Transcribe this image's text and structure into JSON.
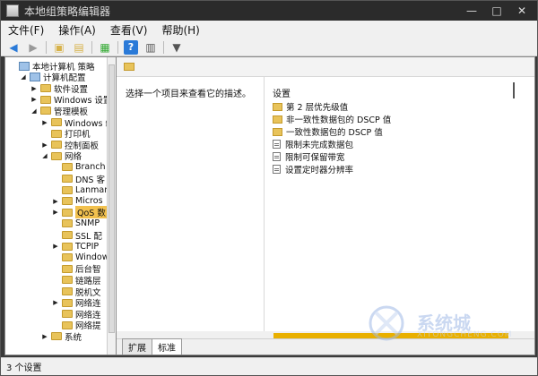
{
  "window": {
    "title": "本地组策略编辑器",
    "controls": [
      "—",
      "□",
      "✕"
    ]
  },
  "menubar": {
    "items": [
      "文件(F)",
      "操作(A)",
      "查看(V)",
      "帮助(H)"
    ]
  },
  "tree": {
    "items": [
      {
        "label": "本地计算机 策略",
        "level": 0,
        "expand": "",
        "icon": "computer-policy-icon"
      },
      {
        "label": "计算机配置",
        "level": 1,
        "expand": "◢",
        "icon": "computer-icon"
      },
      {
        "label": "软件设置",
        "level": 2,
        "expand": "▶",
        "icon": "folder-icon"
      },
      {
        "label": "Windows 设置",
        "level": 2,
        "expand": "▶",
        "icon": "folder-icon"
      },
      {
        "label": "管理模板",
        "level": 2,
        "expand": "◢",
        "icon": "folder-icon"
      },
      {
        "label": "Windows 组",
        "level": 3,
        "expand": "▶",
        "icon": "folder-icon"
      },
      {
        "label": "打印机",
        "level": 3,
        "expand": "",
        "icon": "folder-icon"
      },
      {
        "label": "控制面板",
        "level": 3,
        "expand": "▶",
        "icon": "folder-icon"
      },
      {
        "label": "网络",
        "level": 3,
        "expand": "◢",
        "icon": "folder-icon"
      },
      {
        "label": "Branch",
        "level": 4,
        "expand": "",
        "icon": "folder-icon"
      },
      {
        "label": "DNS 客",
        "level": 4,
        "expand": "",
        "icon": "folder-icon"
      },
      {
        "label": "Lanman",
        "level": 4,
        "expand": "",
        "icon": "folder-icon"
      },
      {
        "label": "Micros",
        "level": 4,
        "expand": "▶",
        "icon": "folder-icon"
      },
      {
        "label": "QoS 数",
        "level": 4,
        "expand": "▶",
        "icon": "folder-icon",
        "selected": true
      },
      {
        "label": "SNMP",
        "level": 4,
        "expand": "",
        "icon": "folder-icon"
      },
      {
        "label": "SSL 配",
        "level": 4,
        "expand": "",
        "icon": "folder-icon"
      },
      {
        "label": "TCPIP",
        "level": 4,
        "expand": "▶",
        "icon": "folder-icon"
      },
      {
        "label": "Window",
        "level": 4,
        "expand": "",
        "icon": "folder-icon"
      },
      {
        "label": "后台智",
        "level": 4,
        "expand": "",
        "icon": "folder-icon"
      },
      {
        "label": "链路层",
        "level": 4,
        "expand": "",
        "icon": "folder-icon"
      },
      {
        "label": "脱机文",
        "level": 4,
        "expand": "",
        "icon": "folder-icon"
      },
      {
        "label": "网络连",
        "level": 4,
        "expand": "▶",
        "icon": "folder-icon"
      },
      {
        "label": "网络连",
        "level": 4,
        "expand": "",
        "icon": "folder-icon"
      },
      {
        "label": "网络提",
        "level": 4,
        "expand": "",
        "icon": "folder-icon"
      },
      {
        "label": "系统",
        "level": 3,
        "expand": "▶",
        "icon": "folder-icon"
      }
    ]
  },
  "details": {
    "description": "选择一个项目来查看它的描述。",
    "list_title": "设置",
    "items": [
      {
        "label": "第 2 层优先级值",
        "type": "folder"
      },
      {
        "label": "非一致性数据包的 DSCP 值",
        "type": "folder"
      },
      {
        "label": "一致性数据包的 DSCP 值",
        "type": "folder"
      },
      {
        "label": "限制未完成数据包",
        "type": "policy"
      },
      {
        "label": "限制可保留带宽",
        "type": "policy"
      },
      {
        "label": "设置定时器分辨率",
        "type": "policy"
      }
    ],
    "tabs": [
      "扩展",
      "标准"
    ]
  },
  "statusbar": {
    "text": "3 个设置"
  },
  "watermark": {
    "text": "系统城",
    "url": "XITONGCHENG.COM"
  }
}
